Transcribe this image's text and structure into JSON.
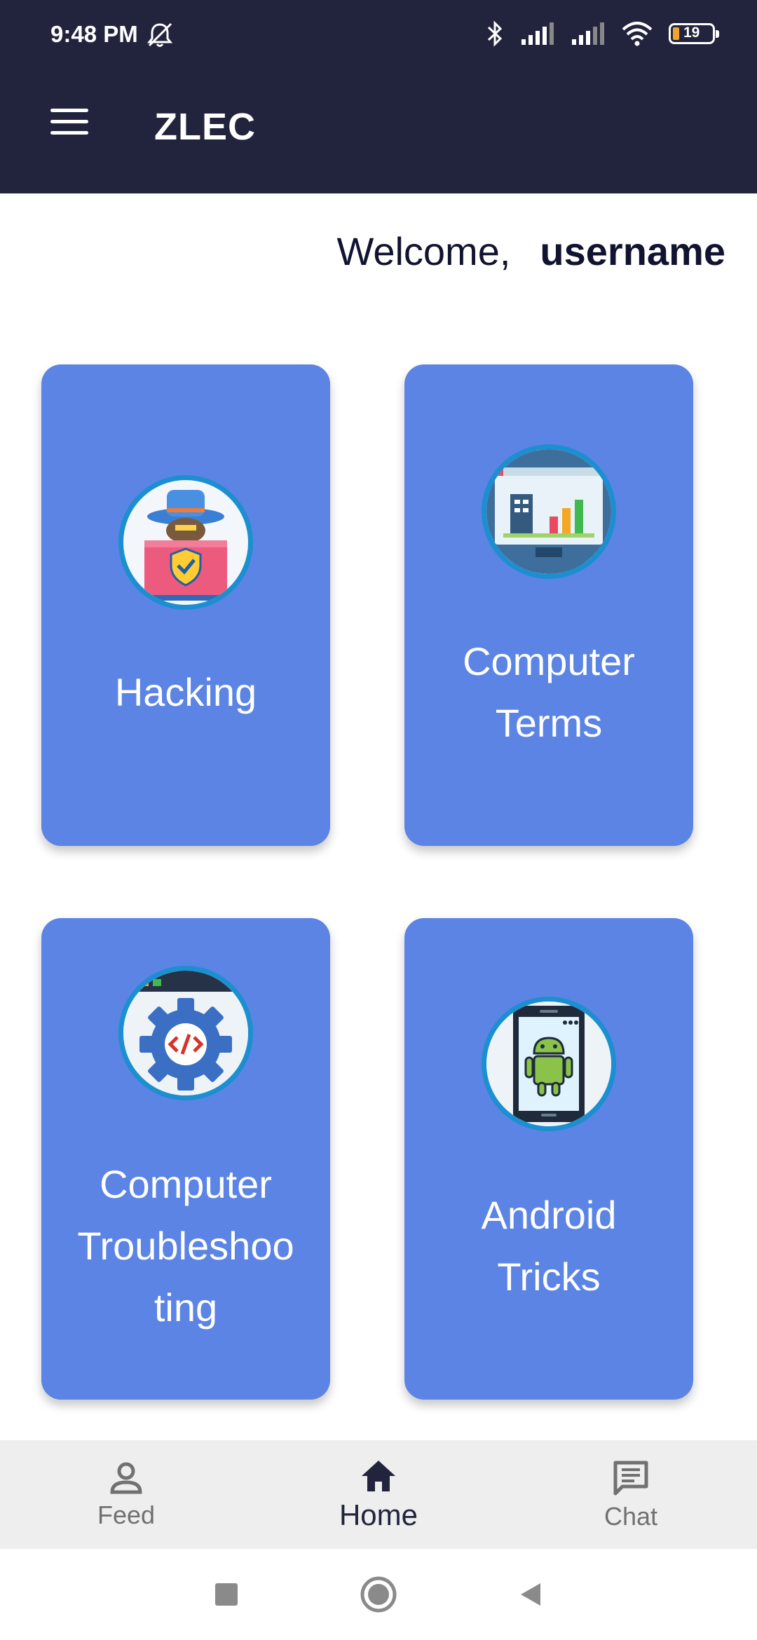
{
  "status_bar": {
    "time": "9:48 PM",
    "battery_level": "19",
    "icons": [
      "bell-off-icon",
      "bluetooth-icon",
      "signal-icon",
      "signal-icon",
      "wifi-icon",
      "battery-icon"
    ]
  },
  "app_bar": {
    "title": "ZLEC",
    "menu_icon": "hamburger-menu-icon"
  },
  "welcome": {
    "label": "Welcome,",
    "username": "username"
  },
  "cards": [
    {
      "label": "Hacking",
      "icon": "hacker-icon"
    },
    {
      "label_lines": [
        "Computer",
        "Terms"
      ],
      "icon": "monitor-chart-icon"
    },
    {
      "label_lines": [
        "Computer",
        "Troubleshoo",
        "ting"
      ],
      "icon": "code-gear-icon"
    },
    {
      "label_lines": [
        "Android",
        "Tricks"
      ],
      "icon": "android-phone-icon"
    }
  ],
  "bottom_nav": {
    "items": [
      {
        "label": "Feed",
        "icon": "person-icon"
      },
      {
        "label": "Home",
        "icon": "home-icon"
      },
      {
        "label": "Chat",
        "icon": "chat-icon"
      }
    ],
    "active": "Home"
  },
  "colors": {
    "app_bar": "#22243e",
    "card": "#5b84e4",
    "icon_ring": "#1b8fd0",
    "bottom_nav_bg": "#eeeeee"
  }
}
